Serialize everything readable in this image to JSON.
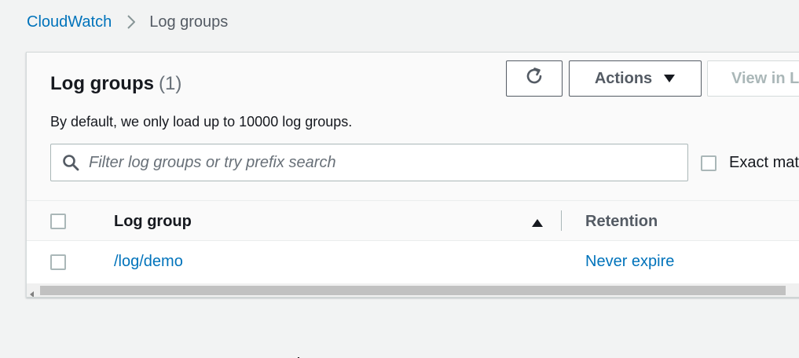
{
  "breadcrumb": {
    "root": "CloudWatch",
    "current": "Log groups"
  },
  "panel": {
    "title": "Log groups",
    "count": "(1)",
    "description": "By default, we only load up to 10000 log groups."
  },
  "toolbar": {
    "refresh_icon": "refresh-icon",
    "actions_label": "Actions",
    "view_label": "View in L"
  },
  "search": {
    "placeholder": "Filter log groups or try prefix search",
    "value": "",
    "exact_label": "Exact mat",
    "exact_checked": false
  },
  "table": {
    "columns": [
      "Log group",
      "Retention"
    ],
    "sort": "ascending",
    "rows": [
      {
        "log_group": "/log/demo",
        "retention": "Never expire",
        "selected": false
      }
    ]
  },
  "colors": {
    "link": "#0073bb",
    "text": "#16191f",
    "muted": "#545b64",
    "background": "#f2f3f3"
  }
}
